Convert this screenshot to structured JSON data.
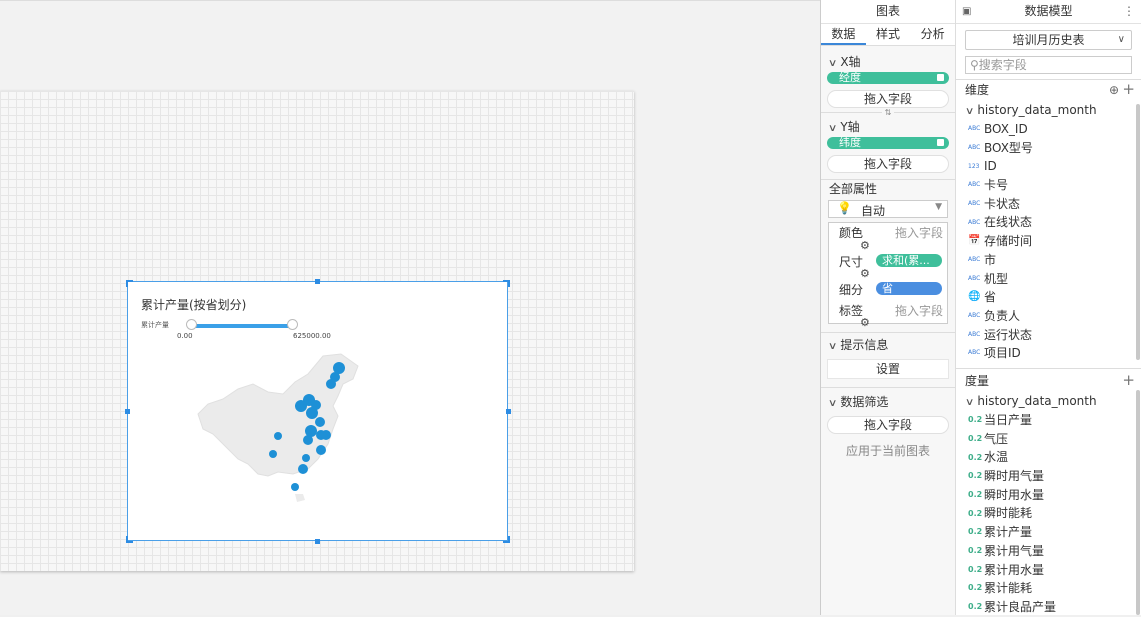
{
  "chart": {
    "title": "累计产量(按省划分)",
    "legend_label": "累计产量",
    "legend_min": "0.00",
    "legend_max": "625000.00"
  },
  "mid_panel": {
    "header": "图表",
    "tabs": [
      "数据",
      "样式",
      "分析"
    ],
    "x_axis": {
      "title": "X轴",
      "pill": "经度",
      "drop": "拖入字段"
    },
    "y_axis": {
      "title": "Y轴",
      "pill": "纬度",
      "drop": "拖入字段"
    },
    "all_props": {
      "title": "全部属性",
      "mode": "自动",
      "color_label": "颜色",
      "color_ph": "拖入字段",
      "size_label": "尺寸",
      "size_tag": "求和(累...",
      "detail_label": "细分",
      "detail_tag": "省",
      "label_label": "标签",
      "label_ph": "拖入字段"
    },
    "tooltip": {
      "title": "提示信息",
      "button": "设置"
    },
    "filter": {
      "title": "数据筛选",
      "drop": "拖入字段",
      "apply": "应用于当前图表"
    }
  },
  "right_panel": {
    "header": "数据模型",
    "table_select": "培训月历史表",
    "search_placeholder": "搜索字段",
    "dimensions": {
      "title": "维度",
      "group": "history_data_month",
      "fields": [
        {
          "icon": "ABC",
          "label": "BOX_ID"
        },
        {
          "icon": "ABC",
          "label": "BOX型号"
        },
        {
          "icon": "123",
          "label": "ID"
        },
        {
          "icon": "ABC",
          "label": "卡号"
        },
        {
          "icon": "ABC",
          "label": "卡状态"
        },
        {
          "icon": "ABC",
          "label": "在线状态"
        },
        {
          "icon": "date",
          "label": "存储时间"
        },
        {
          "icon": "ABC",
          "label": "市"
        },
        {
          "icon": "ABC",
          "label": "机型"
        },
        {
          "icon": "globe",
          "label": "省"
        },
        {
          "icon": "ABC",
          "label": "负责人"
        },
        {
          "icon": "ABC",
          "label": "运行状态"
        },
        {
          "icon": "ABC",
          "label": "项目ID"
        }
      ]
    },
    "measures": {
      "title": "度量",
      "group": "history_data_month",
      "fields": [
        {
          "icon": "0.2",
          "label": "当日产量"
        },
        {
          "icon": "0.2",
          "label": "气压"
        },
        {
          "icon": "0.2",
          "label": "水温"
        },
        {
          "icon": "0.2",
          "label": "瞬时用气量"
        },
        {
          "icon": "0.2",
          "label": "瞬时用水量"
        },
        {
          "icon": "0.2",
          "label": "瞬时能耗"
        },
        {
          "icon": "0.2",
          "label": "累计产量"
        },
        {
          "icon": "0.2",
          "label": "累计用气量"
        },
        {
          "icon": "0.2",
          "label": "累计用水量"
        },
        {
          "icon": "0.2",
          "label": "累计能耗"
        },
        {
          "icon": "0.2",
          "label": "累计良品产量"
        }
      ]
    }
  },
  "colors": {
    "accent": "#3b87d8",
    "pill_green": "#3fbf9b",
    "pill_blue": "#4a8ee0",
    "map_dot": "#1e90d6"
  }
}
